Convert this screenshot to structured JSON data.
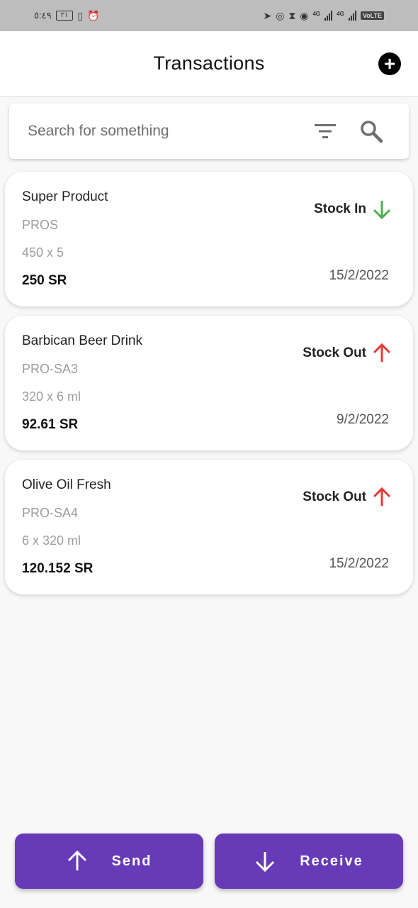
{
  "status_bar": {
    "time": "٥:٤٩",
    "battery": "٢١",
    "network_1": "4G",
    "network_2": "4G",
    "volte": "VoLTE"
  },
  "header": {
    "title": "Transactions",
    "add_icon": "plus-circle-icon"
  },
  "search": {
    "placeholder": "Search for something",
    "value": "",
    "filter_icon": "filter-icon",
    "search_icon": "search-icon"
  },
  "colors": {
    "accent": "#673ab7",
    "stock_in": "#4caf50",
    "stock_out": "#e53935"
  },
  "transactions": [
    {
      "name": "Super Product",
      "code": "PROS",
      "quantity": "450 x 5",
      "price": "250 SR",
      "type": "Stock In",
      "type_icon": "arrow-down-icon",
      "date": "15/2/2022"
    },
    {
      "name": "Barbican Beer Drink",
      "code": "PRO-SA3",
      "quantity": "320 x 6 ml",
      "price": "92.61 SR",
      "type": "Stock Out",
      "type_icon": "arrow-up-icon",
      "date": "9/2/2022"
    },
    {
      "name": "Olive Oil Fresh",
      "code": "PRO-SA4",
      "quantity": "6 x 320 ml",
      "price": "120.152 SR",
      "type": "Stock Out",
      "type_icon": "arrow-up-icon",
      "date": "15/2/2022"
    }
  ],
  "actions": {
    "send_label": "Send",
    "send_icon": "arrow-up-icon",
    "receive_label": "Receive",
    "receive_icon": "arrow-down-icon"
  }
}
